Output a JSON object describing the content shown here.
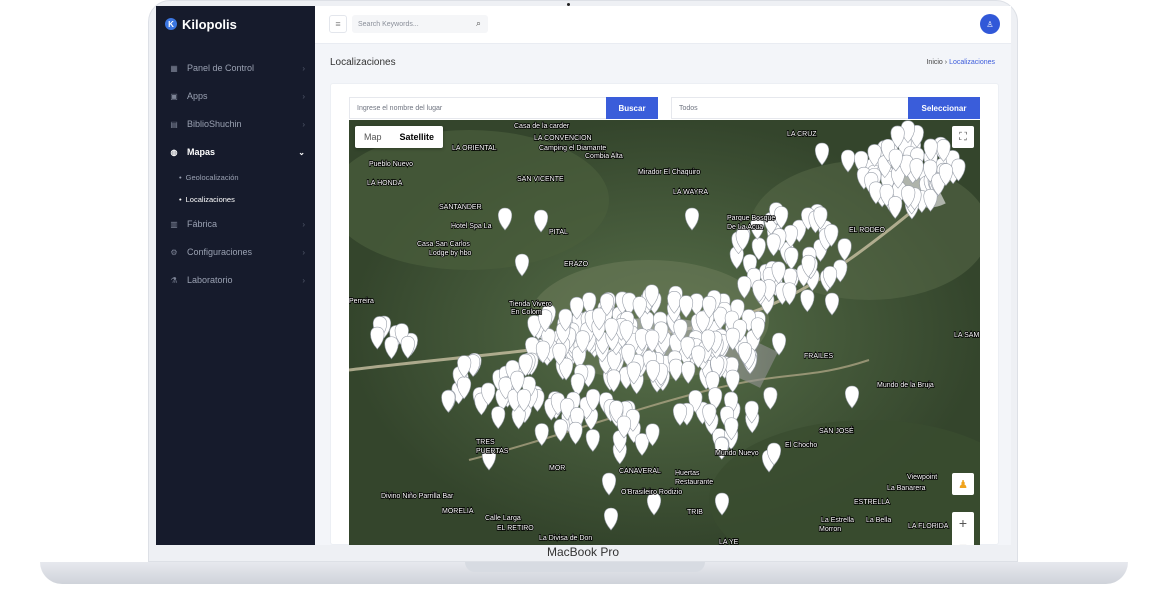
{
  "device": {
    "model": "MacBook Pro"
  },
  "brand": {
    "name": "Kilopolis",
    "logo_letter": "K"
  },
  "sidebar": {
    "items": [
      {
        "label": "Panel de Control",
        "icon": "dashboard-icon"
      },
      {
        "label": "Apps",
        "icon": "apps-icon"
      },
      {
        "label": "BiblioShuchin",
        "icon": "book-icon"
      },
      {
        "label": "Mapas",
        "icon": "globe-icon",
        "active": true
      },
      {
        "label": "Fábrica",
        "icon": "chart-icon"
      },
      {
        "label": "Configuraciones",
        "icon": "gear-icon"
      },
      {
        "label": "Laboratorio",
        "icon": "flask-icon"
      }
    ],
    "sub_items": [
      {
        "label": "Geolocalización"
      },
      {
        "label": "Localizaciones",
        "active": true
      }
    ]
  },
  "topbar": {
    "search_placeholder": "Search Keywords..."
  },
  "page": {
    "title": "Localizaciones",
    "breadcrumb_home": "Inicio",
    "breadcrumb_sep": "›",
    "breadcrumb_current": "Localizaciones"
  },
  "filters": {
    "place_placeholder": "Ingrese el nombre del lugar",
    "search_button": "Buscar",
    "category_value": "Todos",
    "select_button": "Seleccionar"
  },
  "map": {
    "type_map": "Map",
    "type_satellite": "Satellite",
    "zoom_in": "+",
    "labels": [
      "Casa de la carder",
      "LA CONVENCION",
      "Camping el Diamante",
      "Combia Alta",
      "LA CRUZ",
      "LA ORIENTAL",
      "Pueblo Nuevo",
      "SAN VICENTE",
      "Mirador El Chaquiro",
      "LA WAYRA",
      "LA HONDA",
      "SANTANDER",
      "Hotel Spa La",
      "PITAL",
      "Parque Bosque",
      "De La Acua",
      "EL RODEO",
      "Casa San Carlos",
      "Lodge by hbo",
      "ERAZO",
      "Tienda Vivero",
      "En Colom",
      "FRAILES",
      "LA SAM",
      "Perreira",
      "Mundo de la Bruja",
      "SAN JOSÉ",
      "El Chocho",
      "TRES",
      "PUERTAS",
      "Mundo Nuevo",
      "CANAVERAL",
      "Huertas",
      "Restaurante",
      "O'Brasileiro Rodizio",
      "La Banarera",
      "Viewpoint",
      "Divino Niño Parrilla Bar",
      "MORELIA",
      "Calle Larga",
      "EL RETIRO",
      "TRIB",
      "ESTRELLA",
      "La Estrella",
      "Morron",
      "La Bella",
      "LA FLORIDA",
      "La Divisa de Don",
      "LA YE",
      "MOR"
    ]
  }
}
